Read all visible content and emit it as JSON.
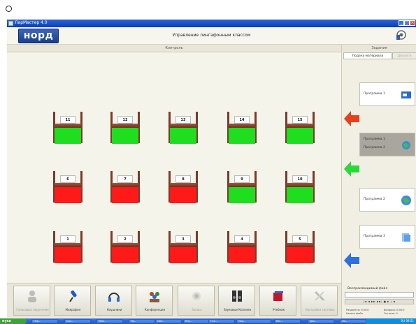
{
  "window": {
    "title": "ЛарМастер 4.0",
    "min_glyph": "_",
    "max_glyph": "□",
    "close_glyph": "×"
  },
  "header": {
    "logo_text": "норд",
    "title": "Управление лингафонным классом"
  },
  "main": {
    "section_title": "Контроль",
    "desks": [
      {
        "num": "11",
        "status": "green"
      },
      {
        "num": "12",
        "status": "green"
      },
      {
        "num": "13",
        "status": "green"
      },
      {
        "num": "14",
        "status": "green"
      },
      {
        "num": "15",
        "status": "green"
      },
      {
        "num": "6",
        "status": "red"
      },
      {
        "num": "7",
        "status": "red"
      },
      {
        "num": "8",
        "status": "red"
      },
      {
        "num": "9",
        "status": "green"
      },
      {
        "num": "10",
        "status": "green"
      },
      {
        "num": "1",
        "status": "red"
      },
      {
        "num": "2",
        "status": "red"
      },
      {
        "num": "3",
        "status": "red"
      },
      {
        "num": "4",
        "status": "red"
      },
      {
        "num": "5",
        "status": "red"
      }
    ],
    "colors": {
      "green": "#1fde1f",
      "red": "#ff1a1a"
    }
  },
  "toolbar": {
    "tools": [
      {
        "label": "Голосовые поручения",
        "icon": "user-icon",
        "enabled": false
      },
      {
        "label": "Микрофон",
        "icon": "microphone-icon",
        "enabled": true
      },
      {
        "label": "Наушники",
        "icon": "headphones-icon",
        "enabled": true
      },
      {
        "label": "Конференция",
        "icon": "group-icon",
        "enabled": true
      },
      {
        "label": "Запись",
        "icon": "record-icon",
        "enabled": false
      },
      {
        "label": "Звуковые Колонки",
        "icon": "speakers-icon",
        "enabled": true
      },
      {
        "label": "Учебник",
        "icon": "book-icon",
        "enabled": true
      },
      {
        "label": "Настройки системы",
        "icon": "tools-icon",
        "enabled": false
      }
    ]
  },
  "right": {
    "title": "Задания",
    "tabs": {
      "active": "Подача материала",
      "inactive": "Диалоги"
    },
    "programs": [
      {
        "label": "Программа 1",
        "label2": "",
        "selected": false
      },
      {
        "label": "Программа 1",
        "label2": "Программа 2",
        "selected": true
      },
      {
        "label": "Программа 2",
        "label2": "",
        "selected": false
      },
      {
        "label": "Программа 3",
        "label2": "",
        "selected": false
      }
    ],
    "arrows": [
      {
        "color": "#e8401c",
        "direction": "left"
      },
      {
        "color": "#2ad83a",
        "direction": "left"
      },
      {
        "color": "#2f6fe0",
        "direction": "left"
      }
    ],
    "file_label": "Воспроизводимый файл",
    "player_controls": "|◀ ◀ ▶▶ ▶▶| ■ ▶ | ◀",
    "stats_left": [
      "Раздается: 0:00:0",
      "Начать файл"
    ],
    "stats_right": [
      "Вопросы: 0:00:0",
      "Остаток: 0"
    ]
  },
  "taskbar": {
    "start_label": "пуск",
    "items": [
      "Пер...",
      "Скр...",
      "Мой...",
      "Пр...",
      "Лин...",
      "Упр...",
      "Гла...",
      "Лар...",
      "Рис...",
      "Док...",
      "Ла..."
    ],
    "tray": "RU  09:51"
  }
}
